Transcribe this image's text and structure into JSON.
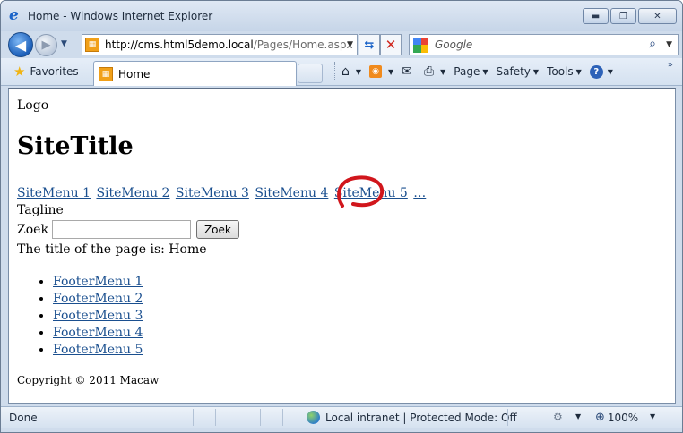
{
  "window": {
    "title": "Home - Windows Internet Explorer",
    "minimize_symbol": "▬",
    "maximize_symbol": "❐",
    "close_symbol": "✕"
  },
  "navigation": {
    "back_symbol": "◀",
    "forward_symbol": "▶",
    "dropdown_symbol": "▼",
    "address_url_host": "http://cms.html5demo.local",
    "address_url_path": "/Pages/Home.aspx",
    "refresh_symbol": "⇆",
    "stop_symbol": "✕",
    "search_placeholder": "Google",
    "search_go_symbol": "⌕"
  },
  "commandbar": {
    "favorites_label": "Favorites",
    "tab_label": "Home",
    "commands": [
      {
        "name": "home",
        "label": "",
        "icon": "⌂"
      },
      {
        "name": "feeds",
        "label": "",
        "icon": "rss"
      },
      {
        "name": "mail",
        "label": "",
        "icon": "✉"
      },
      {
        "name": "print",
        "label": "",
        "icon": "⎙"
      },
      {
        "name": "page",
        "label": "Page"
      },
      {
        "name": "safety",
        "label": "Safety"
      },
      {
        "name": "tools",
        "label": "Tools"
      },
      {
        "name": "help",
        "label": "",
        "icon": "?"
      }
    ],
    "overflow_symbol": "»"
  },
  "page": {
    "logo": "Logo",
    "site_title": "SiteTitle",
    "site_menu": [
      "SiteMenu 1",
      "SiteMenu 2",
      "SiteMenu 3",
      "SiteMenu 4",
      "SiteMenu 5",
      "…"
    ],
    "tagline": "Tagline",
    "search_label": "Zoek",
    "search_button": "Zoek",
    "page_title_text": "The title of the page is: Home",
    "footer_menu": [
      "FooterMenu 1",
      "FooterMenu 2",
      "FooterMenu 3",
      "FooterMenu 4",
      "FooterMenu 5"
    ],
    "copyright": "Copyright © 2011 Macaw"
  },
  "status": {
    "text": "Done",
    "zone": "Local intranet | Protected Mode: Off",
    "zoom": "100%"
  },
  "colors": {
    "link": "#1a4f8f",
    "annotation_circle": "#d1161c",
    "frame": "#cfdcec"
  }
}
